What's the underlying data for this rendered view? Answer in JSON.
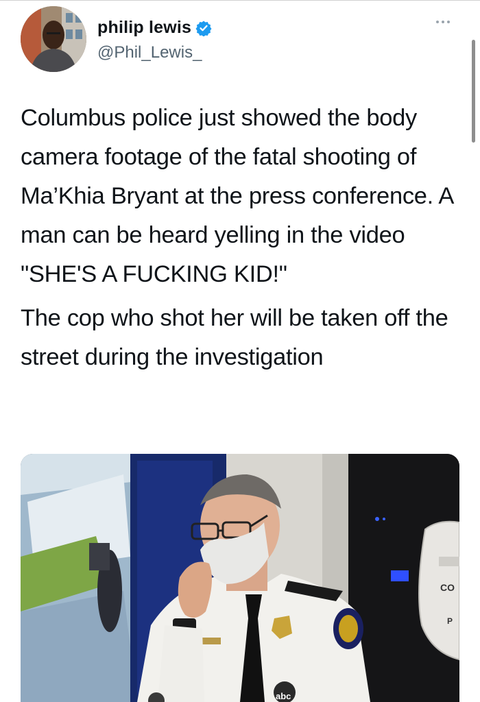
{
  "author": {
    "display_name": "philip lewis",
    "handle": "@Phil_Lewis_",
    "verified": true,
    "avatar_icon": "profile-photo",
    "verified_icon": "verified-badge-icon"
  },
  "more_icon": "ellipsis-icon",
  "tweet": {
    "paragraphs": [
      "Columbus police just showed the body camera footage of the fatal shooting of Ma’Khia Bryant at the press conference. A man can be heard yelling in the video \"SHE'S A FUCKING KID!\"",
      "The cop who shot her will be taken off the street during the investigation"
    ]
  },
  "media": {
    "badge_text": "CO",
    "badge_text_2": "P",
    "mic_logo": "abc"
  },
  "colors": {
    "text": "#0f1419",
    "handle": "#536471",
    "verified": "#1d9bf0"
  }
}
